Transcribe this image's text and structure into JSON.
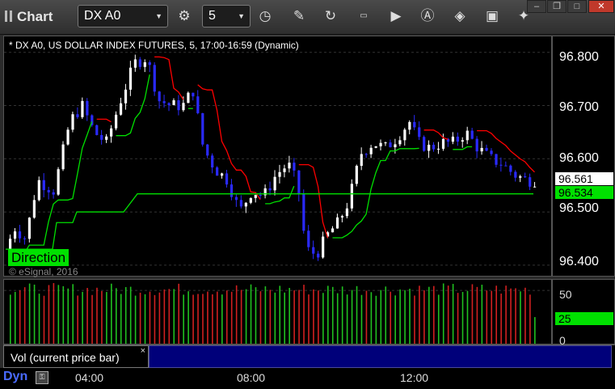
{
  "toolbar": {
    "title": "Chart",
    "symbol": "DX A0",
    "interval": "5",
    "icons": [
      "gear-icon",
      "clock-icon",
      "pencil-icon",
      "refresh-icon",
      "get-icon",
      "play-icon",
      "alert-icon",
      "tag-icon",
      "chat-icon",
      "twitter-icon"
    ]
  },
  "chart": {
    "title": "* DX A0, US DOLLAR INDEX FUTURES, 5, 17:00-16:59 (Dynamic)",
    "copyright": "© eSignal, 2016",
    "direction_label": "Direction",
    "last_price": "96.561",
    "trend_price": "96.534",
    "colors": {
      "up": "#ffffff",
      "down": "#2a2aff",
      "trail_up": "#00e000",
      "trail_down": "#ff0000",
      "flat": "#00e000"
    }
  },
  "chart_data": {
    "type": "candlestick",
    "price_ticks": [
      "96.800",
      "96.700",
      "96.600",
      "96.500",
      "96.400"
    ],
    "ylim": [
      96.38,
      96.83
    ],
    "volume_ticks": [
      "50",
      "25",
      "0"
    ],
    "volume_current": "25",
    "time_labels": [
      "04:00",
      "08:00",
      "12:00"
    ],
    "flat_line": 96.534
  },
  "study": {
    "label": "Vol (current price bar)",
    "close": "×"
  },
  "footer": {
    "mode": "Dyn"
  }
}
